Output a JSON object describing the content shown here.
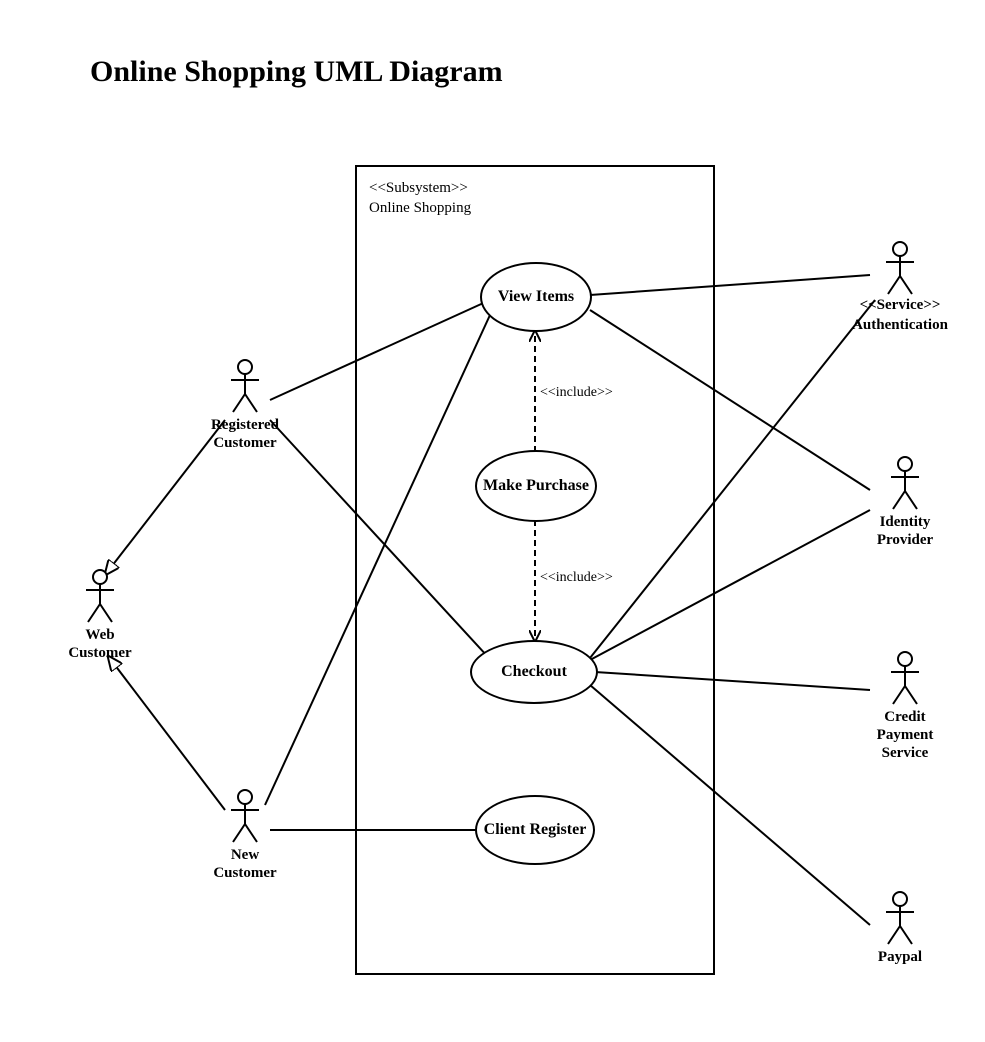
{
  "title": "Online Shopping UML Diagram",
  "system": {
    "stereotype": "<<Subsystem>>",
    "name": "Online Shopping"
  },
  "usecases": {
    "view_items": "View Items",
    "make_purchase": "Make Purchase",
    "checkout": "Checkout",
    "client_register": "Client Register"
  },
  "relations": {
    "include1": "<<include>>",
    "include2": "<<include>>"
  },
  "actors": {
    "web_customer": "Web Customer",
    "registered_customer": "Registered Customer",
    "new_customer": "New Customer",
    "authentication_stereo": "<<Service>>",
    "authentication": "Authentication",
    "identity_provider": "Identity Provider",
    "credit_payment_service": "Credit Payment Service",
    "paypal": "Paypal"
  },
  "connections": [
    {
      "from": "registered_customer",
      "to": "web_customer",
      "type": "generalization"
    },
    {
      "from": "new_customer",
      "to": "web_customer",
      "type": "generalization"
    },
    {
      "from": "registered_customer",
      "to": "view_items",
      "type": "association"
    },
    {
      "from": "registered_customer",
      "to": "checkout",
      "type": "association"
    },
    {
      "from": "new_customer",
      "to": "view_items",
      "type": "association"
    },
    {
      "from": "new_customer",
      "to": "client_register",
      "type": "association"
    },
    {
      "from": "make_purchase",
      "to": "view_items",
      "type": "include"
    },
    {
      "from": "make_purchase",
      "to": "checkout",
      "type": "include"
    },
    {
      "from": "view_items",
      "to": "authentication",
      "type": "association"
    },
    {
      "from": "view_items",
      "to": "identity_provider",
      "type": "association"
    },
    {
      "from": "checkout",
      "to": "authentication",
      "type": "association"
    },
    {
      "from": "checkout",
      "to": "identity_provider",
      "type": "association"
    },
    {
      "from": "checkout",
      "to": "credit_payment_service",
      "type": "association"
    },
    {
      "from": "checkout",
      "to": "paypal",
      "type": "association"
    }
  ]
}
